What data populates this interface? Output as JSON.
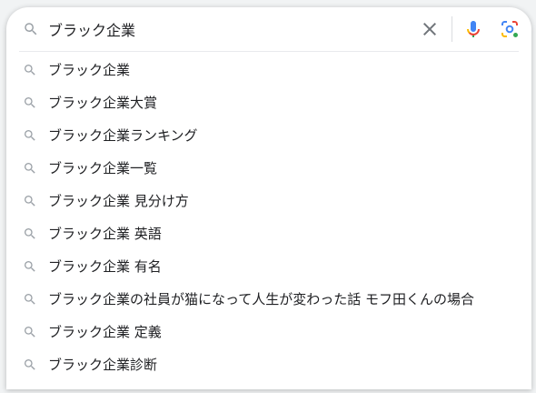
{
  "search": {
    "query": "ブラック企業"
  },
  "icons": {
    "lead": "search-icon",
    "clear": "close-icon",
    "voice": "microphone-icon",
    "lens": "camera-lens-icon",
    "suggestion": "search-icon"
  },
  "colors": {
    "icon_gray": "#9aa0a6",
    "text": "#202124",
    "clear_icon": "#70757a",
    "mic_blue": "#4285f4",
    "mic_red": "#ea4335",
    "mic_yellow": "#fbbc04",
    "mic_green": "#34a853"
  },
  "suggestions": [
    {
      "label": "ブラック企業"
    },
    {
      "label": "ブラック企業大賞"
    },
    {
      "label": "ブラック企業ランキング"
    },
    {
      "label": "ブラック企業一覧"
    },
    {
      "label": "ブラック企業 見分け方"
    },
    {
      "label": "ブラック企業 英語"
    },
    {
      "label": "ブラック企業 有名"
    },
    {
      "label": "ブラック企業の社員が猫になって人生が変わった話 モフ田くんの場合"
    },
    {
      "label": "ブラック企業 定義"
    },
    {
      "label": "ブラック企業診断"
    }
  ]
}
